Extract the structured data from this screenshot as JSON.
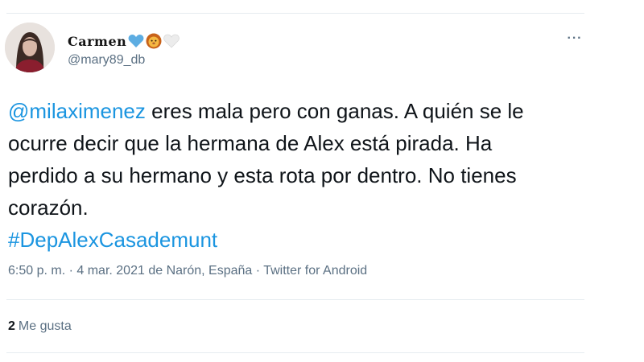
{
  "author": {
    "display_name": "Carmen",
    "name_emojis": [
      "blue-heart-icon",
      "lion-face-icon",
      "white-heart-icon"
    ],
    "handle": "@mary89_db"
  },
  "more_menu": {
    "label": "···"
  },
  "tweet": {
    "mention": "@milaximenez",
    "line1_rest": " eres mala pero con ganas. A quién se le",
    "line2": "ocurre decir que la hermana de Alex está pirada. Ha",
    "line3": "perdido a su hermano y esta rota por dentro. No tienes",
    "line4": "corazón.",
    "hashtag": "#DepAlexCasademunt"
  },
  "meta": {
    "time": "6:50 p. m.",
    "sep1": " · ",
    "date": "4 mar. 2021",
    "location": " de Narón, España",
    "sep2": " · ",
    "source": "Twitter for Android"
  },
  "engagement": {
    "likes_count": "2",
    "likes_label": "Me gusta"
  },
  "colors": {
    "link": "#1b95e0",
    "secondary_text": "#5b7083",
    "divider": "#e6ecf0"
  }
}
